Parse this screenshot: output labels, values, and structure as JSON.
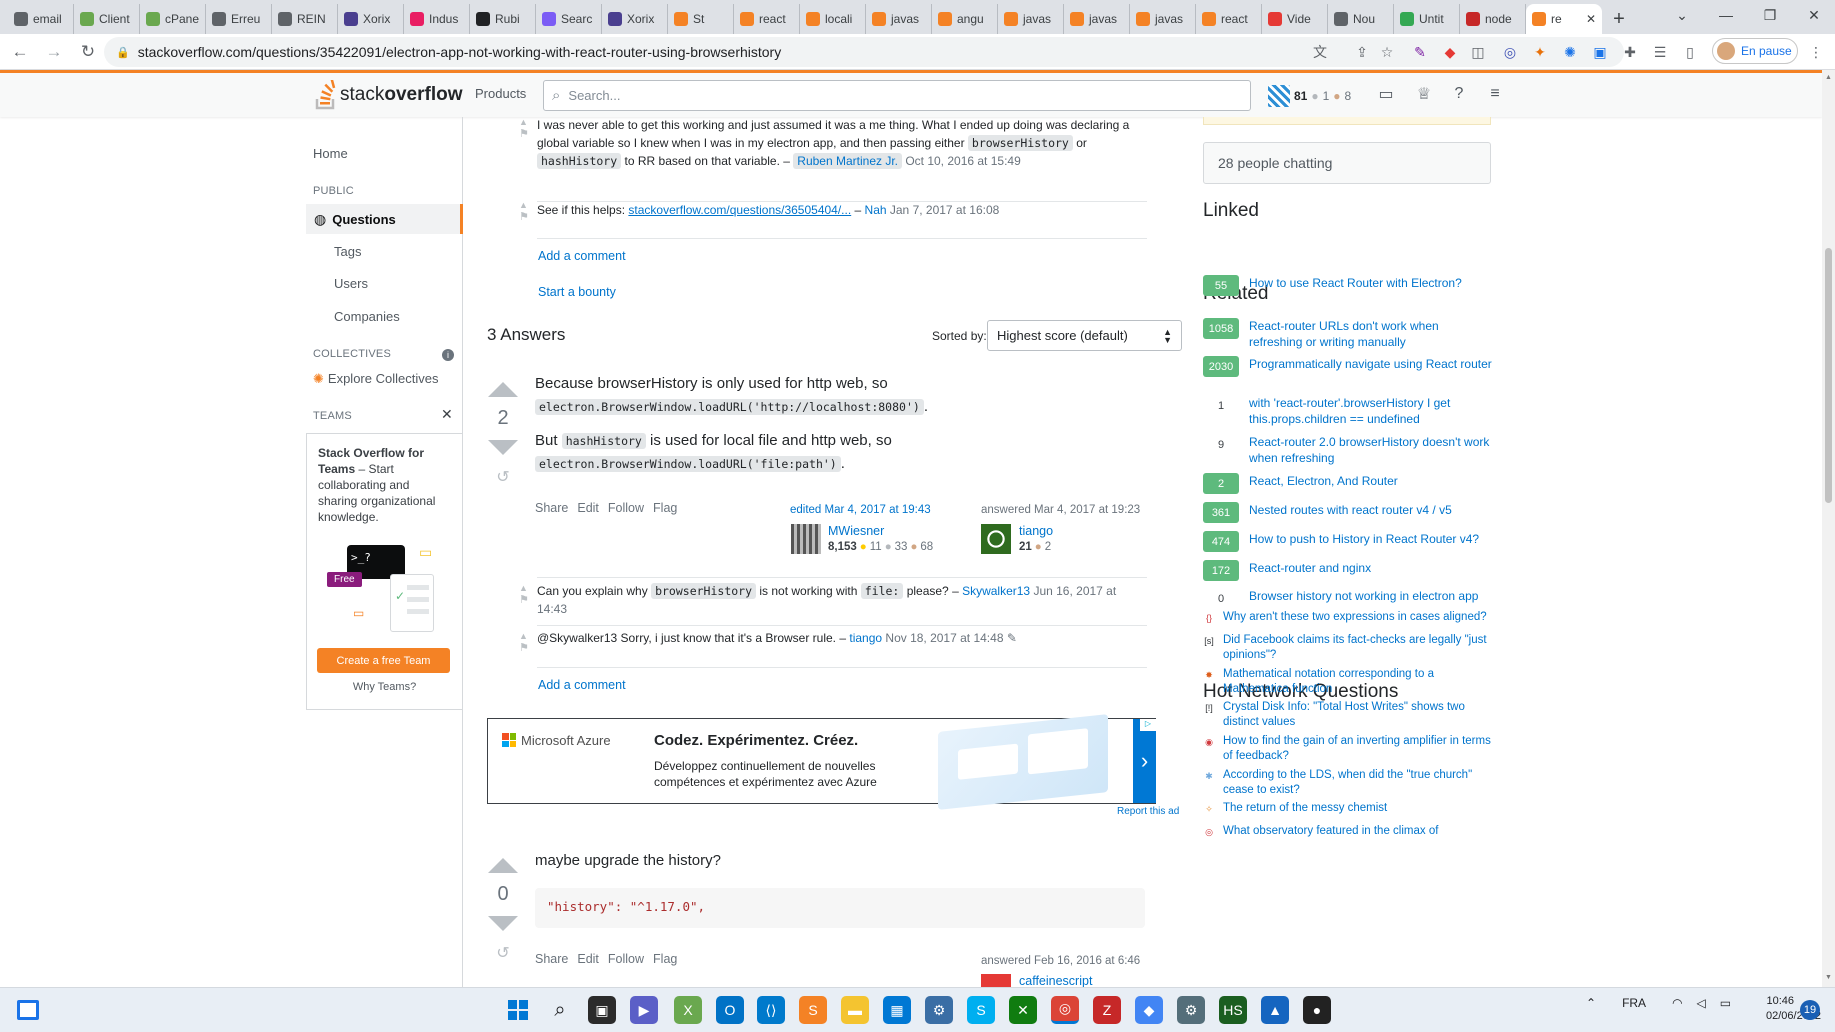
{
  "browser": {
    "tabs": [
      {
        "label": "email",
        "color": "#5f6368"
      },
      {
        "label": "Client",
        "color": "#6aa84f"
      },
      {
        "label": "cPane",
        "color": "#6aa84f"
      },
      {
        "label": "Erreu",
        "color": "#5f6368"
      },
      {
        "label": "REIN",
        "color": "#5f6368"
      },
      {
        "label": "Xorix",
        "color": "#4a3f8f"
      },
      {
        "label": "Indus",
        "color": "#e91e63"
      },
      {
        "label": "Rubi",
        "color": "#202124"
      },
      {
        "label": "Searc",
        "color": "#7b5cf5"
      },
      {
        "label": "Xorix",
        "color": "#4a3f8f"
      },
      {
        "label": "St",
        "color": "#f48225"
      },
      {
        "label": "react",
        "color": "#f48225"
      },
      {
        "label": "locali",
        "color": "#f48225"
      },
      {
        "label": "javas",
        "color": "#f48225"
      },
      {
        "label": "angu",
        "color": "#f48225"
      },
      {
        "label": "javas",
        "color": "#f48225"
      },
      {
        "label": "javas",
        "color": "#f48225"
      },
      {
        "label": "javas",
        "color": "#f48225"
      },
      {
        "label": "react",
        "color": "#f48225"
      },
      {
        "label": "Vide",
        "color": "#e53935"
      },
      {
        "label": "Nou",
        "color": "#5f6368"
      },
      {
        "label": "Untit",
        "color": "#34a853"
      },
      {
        "label": "node",
        "color": "#c62828"
      }
    ],
    "active_tab": {
      "label": "re",
      "close": "✕"
    },
    "new_tab": "+",
    "url": "stackoverflow.com/questions/35422091/electron-app-not-working-with-react-router-using-browserhistory",
    "profile_label": "En pause"
  },
  "so_header": {
    "logo_text_light": "stack",
    "logo_text_bold": "overflow",
    "products": "Products",
    "search_placeholder": "Search...",
    "rep": "81",
    "silver": "1",
    "bronze": "8"
  },
  "leftnav": {
    "home": "Home",
    "public": "PUBLIC",
    "questions": "Questions",
    "tags": "Tags",
    "users": "Users",
    "companies": "Companies",
    "collectives": "COLLECTIVES",
    "explore_collectives": "Explore Collectives",
    "teams": "TEAMS",
    "teams_title": "Stack Overflow for Teams",
    "teams_desc": " – Start collaborating and sharing organizational knowledge.",
    "free_badge": "Free",
    "create_team": "Create a free Team",
    "why_teams": "Why Teams?"
  },
  "question_comments": [
    {
      "text_a": "I was never able to get this working and just assumed it was a me thing. What I ended up doing was declaring a global variable so I knew when I was in my electron app, and then passing either ",
      "code1": "browserHistory",
      "mid": " or ",
      "code2": "hashHistory",
      "text_b": " to RR based on that variable. – ",
      "user": "Ruben Martinez Jr.",
      "date": " Oct 10, 2016 at 15:49"
    },
    {
      "text_a": "See if this helps: ",
      "link": "stackoverflow.com/questions/36505404/...",
      "text_b": " – ",
      "user": "Nah",
      "date": " Jan 7, 2017 at 16:08"
    }
  ],
  "add_comment": "Add a comment",
  "start_bounty": "Start a bounty",
  "answers_header": {
    "count_label": "3 Answers",
    "sorted_by": "Sorted by:",
    "sort_value": "Highest score (default)"
  },
  "answer1": {
    "votes": "2",
    "line1_text": "Because browserHistory is only used for http web, so",
    "line1_code": "electron.BrowserWindow.loadURL('http://localhost:8080')",
    "line1_end": ".",
    "line2_a": "But ",
    "line2_code": "hashHistory",
    "line2_b": " is used for local file and http web, so",
    "line2_code2": "electron.BrowserWindow.loadURL('file:path')",
    "line2_end": ".",
    "share": "Share",
    "edit": "Edit",
    "follow": "Follow",
    "flag": "Flag",
    "edited": "edited Mar 4, 2017 at 19:43",
    "editor_name": "MWiesner",
    "editor_rep": "8,153",
    "editor_gold": "11",
    "editor_silver": "33",
    "editor_bronze": "68",
    "answered": "answered Mar 4, 2017 at 19:23",
    "author_name": "tiango",
    "author_rep": "21",
    "author_bronze": "2",
    "comments": [
      {
        "text_a": "Can you explain why ",
        "code1": "browserHistory",
        "mid": " is not working with ",
        "code2": "file:",
        "text_b": " please? – ",
        "user": "Skywalker13",
        "date": " Jun 16, 2017 at 14:43"
      },
      {
        "text_a": "@Skywalker13 Sorry, i just know that it's a Browser rule. – ",
        "user": "tiango",
        "date": " Nov 18, 2017 at 14:48"
      }
    ],
    "add_comment": "Add a comment"
  },
  "ad": {
    "brand": "Microsoft Azure",
    "headline": "Codez. Expérimentez. Créez.",
    "sub1": "Développez continuellement de nouvelles",
    "sub2": "compétences et expérimentez avec Azure",
    "report": "Report this ad"
  },
  "answer2": {
    "votes": "0",
    "body": "maybe upgrade the history?",
    "code": "\"history\": \"^1.17.0\",",
    "share": "Share",
    "edit": "Edit",
    "follow": "Follow",
    "flag": "Flag",
    "answered": "answered Feb 16, 2016 at 6:46",
    "author_name": "caffeinescript"
  },
  "rightbar": {
    "chatting": "28 people chatting",
    "linked_title": "Linked",
    "linked": [
      {
        "score": "55",
        "title": "How to use React Router with Electron?",
        "answered": true
      }
    ],
    "related_title": "Related",
    "related": [
      {
        "score": "1058",
        "title": "React-router URLs don't work when refreshing or writing manually",
        "answered": true
      },
      {
        "score": "2030",
        "title": "Programmatically navigate using React router",
        "answered": true
      },
      {
        "score": "1",
        "title": "with 'react-router'.browserHistory I get this.props.children == undefined",
        "answered": false
      },
      {
        "score": "9",
        "title": "React-router 2.0 browserHistory doesn't work when refreshing",
        "answered": false
      },
      {
        "score": "2",
        "title": "React, Electron, And Router",
        "answered": true
      },
      {
        "score": "361",
        "title": "Nested routes with react router v4 / v5",
        "answered": true
      },
      {
        "score": "474",
        "title": "How to push to History in React Router v4?",
        "answered": true
      },
      {
        "score": "172",
        "title": "React-router and nginx",
        "answered": true
      },
      {
        "score": "0",
        "title": "Browser history not working in electron app",
        "answered": false
      }
    ],
    "hnq_title": "Hot Network Questions",
    "hnq": [
      {
        "title": "Why aren't these two expressions in cases aligned?",
        "icon": "{}",
        "color": "#d0393e"
      },
      {
        "title": "Did Facebook claims its fact-checks are legally \"just opinions\"?",
        "icon": "[s]",
        "color": "#2f3337"
      },
      {
        "title": "Mathematical notation corresponding to a Mathematica function",
        "icon": "✸",
        "color": "#dd5e1c"
      },
      {
        "title": "Crystal Disk Info: \"Total Host Writes\" shows two distinct values",
        "icon": "[!]",
        "color": "#2f3337"
      },
      {
        "title": "How to find the gain of an inverting amplifier in terms of feedback?",
        "icon": "◉",
        "color": "#d0393e"
      },
      {
        "title": "According to the LDS, when did the \"true church\" cease to exist?",
        "icon": "✱",
        "color": "#6fa8dc"
      },
      {
        "title": "The return of the messy chemist",
        "icon": "✧",
        "color": "#e69138"
      },
      {
        "title": "What observatory featured in the climax of",
        "icon": "◎",
        "color": "#d0393e"
      }
    ]
  },
  "taskbar": {
    "lang": "FRA",
    "time": "10:46",
    "date": "02/06/2022",
    "notif_count": "19"
  }
}
